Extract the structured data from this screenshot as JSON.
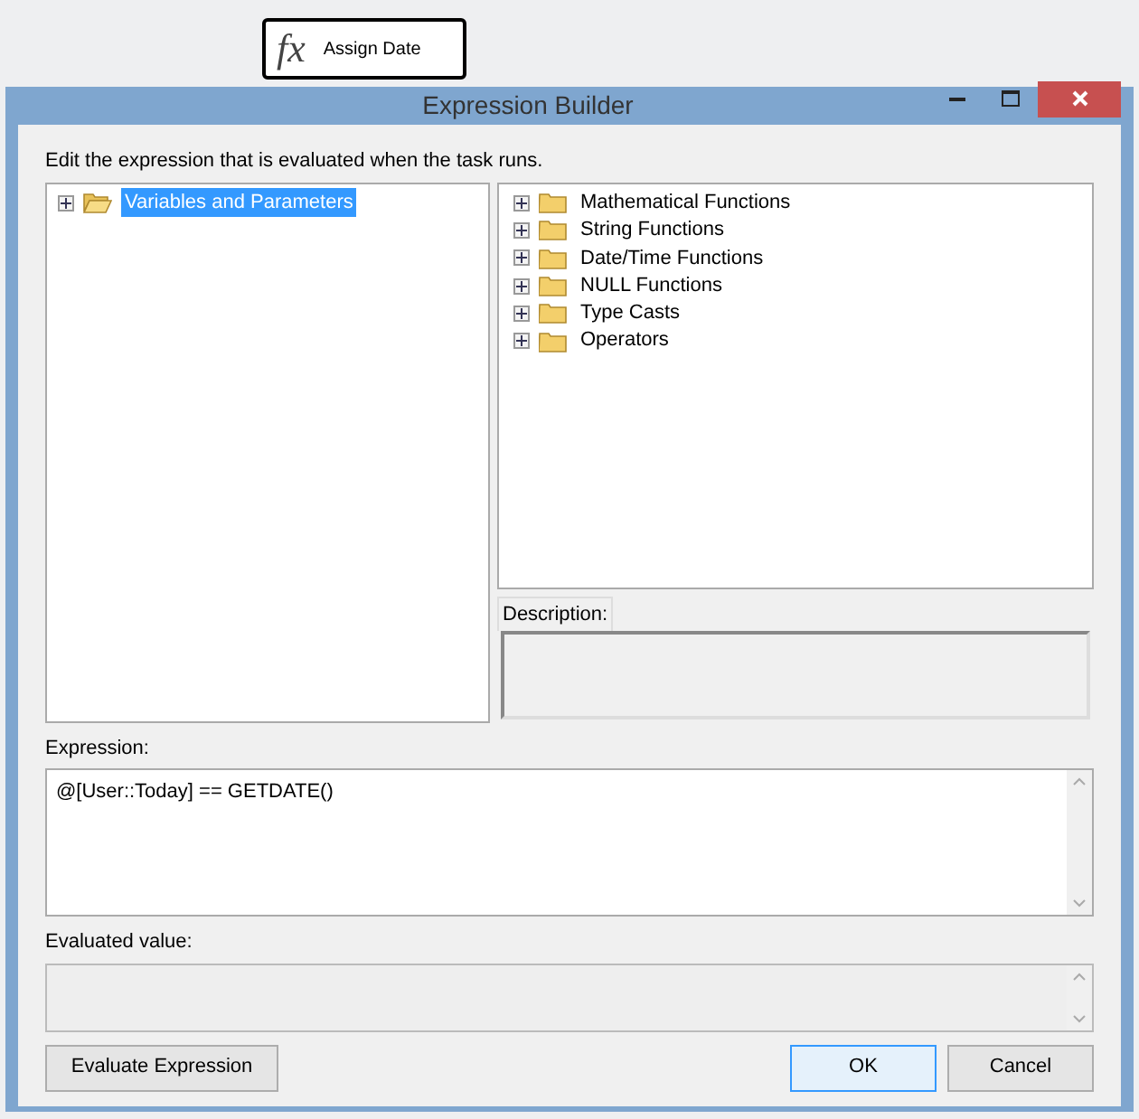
{
  "task_node": {
    "icon_text": "fx",
    "label": "Assign Date"
  },
  "window": {
    "title": "Expression Builder"
  },
  "instructions": "Edit the expression that is evaluated when the task runs.",
  "variables_tree": [
    {
      "label": "Variables and Parameters",
      "selected": true,
      "open": true
    }
  ],
  "functions_tree": [
    {
      "label": "Mathematical Functions",
      "selected": false,
      "open": false
    },
    {
      "label": "String Functions",
      "selected": false,
      "open": false
    },
    {
      "label": "Date/Time Functions",
      "selected": false,
      "open": false
    },
    {
      "label": "NULL Functions",
      "selected": false,
      "open": false
    },
    {
      "label": "Type Casts",
      "selected": false,
      "open": false
    },
    {
      "label": "Operators",
      "selected": false,
      "open": false
    }
  ],
  "description": {
    "label": "Description:"
  },
  "expression": {
    "label": "Expression:",
    "value": "@[User::Today] == GETDATE()"
  },
  "evaluated_value": {
    "label": "Evaluated value:"
  },
  "buttons": [
    {
      "label": "Evaluate Expression",
      "default": false,
      "kind": "action"
    },
    {
      "label": "OK",
      "default": true,
      "kind": "confirm"
    },
    {
      "label": "Cancel",
      "default": false,
      "kind": "confirm"
    }
  ]
}
